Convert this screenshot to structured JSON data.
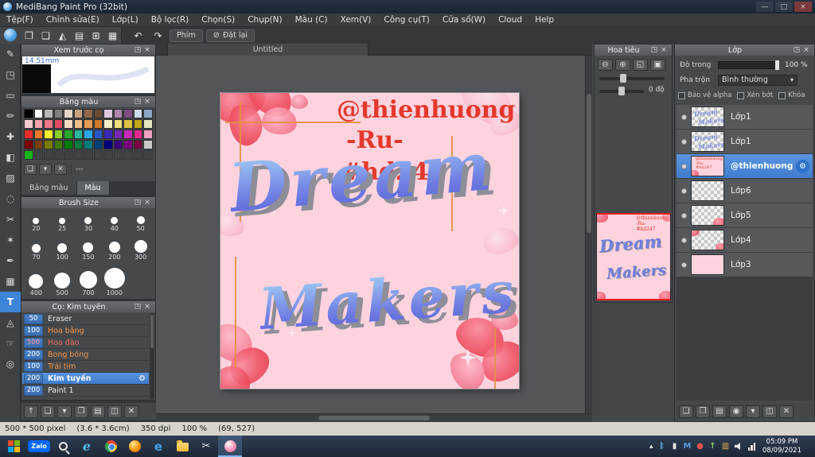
{
  "ui": {
    "popout": "◳",
    "close": "×",
    "gear": "⚙",
    "dropdown": "▾",
    "tray_expand": "▴"
  },
  "titlebar": {
    "title": "MediBang Paint Pro (32bit)",
    "min": "—",
    "max": "□",
    "close": "×"
  },
  "menubar": {
    "items": [
      "Tệp(F)",
      "Chỉnh sửa(E)",
      "Lớp(L)",
      "Bộ lọc(R)",
      "Chọn(S)",
      "Chụp(N)",
      "Màu (C)",
      "Xem(V)",
      "Công cụ(T)",
      "Cửa sổ(W)",
      "Cloud",
      "Help"
    ]
  },
  "toolbar": {
    "icons": [
      {
        "name": "new-canvas-icon",
        "glyph": "❐"
      },
      {
        "name": "save-icon",
        "glyph": "❏"
      },
      {
        "name": "comment-icon",
        "glyph": "◭"
      },
      {
        "name": "open-file-icon",
        "glyph": "▤"
      },
      {
        "name": "canvas-settings-icon",
        "glyph": "⊞"
      },
      {
        "name": "grid-icon",
        "glyph": "▦"
      }
    ],
    "undo": "↶",
    "redo": "↷",
    "key_button": "Phím",
    "reset_glyph": "⊘",
    "reset_button": "Đặt lại"
  },
  "tools": {
    "items": [
      {
        "name": "pen-tool",
        "glyph": "✎"
      },
      {
        "name": "eraser-tool",
        "glyph": "◳"
      },
      {
        "name": "select-rect-tool",
        "glyph": "▭"
      },
      {
        "name": "brush-tool",
        "glyph": "✏"
      },
      {
        "name": "move-tool",
        "glyph": "✚"
      },
      {
        "name": "fill-tool",
        "glyph": "◧"
      },
      {
        "name": "gradient-tool",
        "glyph": "▨"
      },
      {
        "name": "select-ellipse-tool",
        "glyph": "◌"
      },
      {
        "name": "lasso-tool",
        "glyph": "✂"
      },
      {
        "name": "magic-wand-tool",
        "glyph": "✶"
      },
      {
        "name": "pen-nib-tool",
        "glyph": "✒"
      },
      {
        "name": "transform-tool",
        "glyph": "▦"
      },
      {
        "name": "text-tool",
        "glyph": "T",
        "selected": true
      },
      {
        "name": "shape-tool",
        "glyph": "◬"
      },
      {
        "name": "hand-tool",
        "glyph": "☞"
      },
      {
        "name": "zoom-tool",
        "glyph": "◎"
      }
    ]
  },
  "preview": {
    "title": "Xem trước cọ",
    "size_label": "14.51mm"
  },
  "palette": {
    "title": "Bảng màu",
    "colors": [
      "#000000",
      "#ffffff",
      "#b9b9b9",
      "#7f7f7f",
      "#e5d5c5",
      "#caa27e",
      "#93684a",
      "#6b4a33",
      "#e0cade",
      "#af85ae",
      "#7e4f7e",
      "#cfdcea",
      "#89a8c8",
      "#f7cdd1",
      "#f2a3ad",
      "#ec7787",
      "#e14b60",
      "#f6dcc1",
      "#eebd8c",
      "#e39a52",
      "#d2782a",
      "#f7f0c6",
      "#eedd7d",
      "#ddc243",
      "#c3a618",
      "#e6e6c0",
      "#e82c2c",
      "#f07828",
      "#f8f028",
      "#88d028",
      "#28a828",
      "#28b89a",
      "#28a8e8",
      "#2858c8",
      "#3828b8",
      "#7828b8",
      "#c828b8",
      "#e8288a",
      "#f0a0c0",
      "#790000",
      "#7a3e00",
      "#7a7a00",
      "#3e7a00",
      "#007a00",
      "#007a3e",
      "#007a7a",
      "#003e7a",
      "#00007a",
      "#3e007a",
      "#7a007a",
      "#7a003e",
      "#c9c9c9",
      "#19b219",
      "",
      "",
      "",
      "",
      "",
      "",
      "",
      "",
      "",
      "",
      "",
      ""
    ],
    "action_icons": [
      {
        "name": "add-color-icon",
        "glyph": "❏"
      },
      {
        "name": "palette-menu-icon",
        "glyph": "▾"
      },
      {
        "name": "delete-color-icon",
        "glyph": "✕"
      }
    ],
    "swatch_label": "---",
    "tabs": [
      {
        "label": "Bảng màu",
        "active": false
      },
      {
        "label": "Màu",
        "active": true
      }
    ]
  },
  "brush_size": {
    "title": "Brush Size",
    "sizes": [
      20,
      25,
      30,
      40,
      50,
      70,
      100,
      150,
      200,
      300,
      400,
      500,
      700,
      1000
    ]
  },
  "brushes": {
    "title": "Cọ: Kim tuyến",
    "items": [
      {
        "size": "50",
        "name": "Eraser",
        "name_color": "#e8e8e8",
        "size_color": "#ffffff"
      },
      {
        "size": "100",
        "name": "Hoa bằng",
        "name_color": "#f0954a",
        "size_color": "#ffffff"
      },
      {
        "size": "500",
        "name": "Hoa đào",
        "name_color": "#ef6a5a",
        "size_color": "#ff9090"
      },
      {
        "size": "200",
        "name": "Bong bóng",
        "name_color": "#f0954a",
        "size_color": "#ffffff"
      },
      {
        "size": "100",
        "name": "Trái tim",
        "name_color": "#f0954a",
        "size_color": "#ffffff"
      },
      {
        "size": "200",
        "name": "Kim tuyến",
        "name_color": "#ffffff",
        "size_color": "#ffffff",
        "selected": true
      },
      {
        "size": "200",
        "name": "Paint 1",
        "name_color": "#e8e8e8",
        "size_color": "#ffffff"
      }
    ],
    "bottom_icons": [
      {
        "name": "brush-up-icon",
        "glyph": "↑"
      },
      {
        "name": "add-brush-icon",
        "glyph": "❏"
      },
      {
        "name": "brush-menu-icon",
        "glyph": "▾"
      },
      {
        "name": "duplicate-brush-icon",
        "glyph": "❐"
      },
      {
        "name": "brush-folder-icon",
        "glyph": "▤"
      },
      {
        "name": "copy-brush-icon",
        "glyph": "◫"
      },
      {
        "name": "delete-brush-icon",
        "glyph": "✕"
      }
    ]
  },
  "canvas": {
    "tab": "Untitled"
  },
  "artwork": {
    "line1": "@thienhuong",
    "line2": "-Ru-",
    "line3": "#hd247",
    "word1": "Dream",
    "word2": "Makers"
  },
  "navigator": {
    "title": "Hoa tiêu",
    "rotation": "0 độ",
    "buttons": [
      {
        "name": "zoom-out-icon",
        "glyph": "⊖"
      },
      {
        "name": "zoom-in-icon",
        "glyph": "⊕"
      },
      {
        "name": "fit-view-icon",
        "glyph": "◱"
      },
      {
        "name": "actual-size-icon",
        "glyph": "▣"
      }
    ]
  },
  "layers": {
    "title": "Lớp",
    "opacity_label": "Độ trong",
    "opacity_value": "100 %",
    "blend_label": "Pha trộn",
    "blend_value": "Bình thường",
    "checkboxes": [
      "Bảo vệ alpha",
      "Xén bớt",
      "Khóa"
    ],
    "items": [
      {
        "name": "Lớp1",
        "thumb": "words"
      },
      {
        "name": "Lớp1",
        "thumb": "words"
      },
      {
        "name": "@thienhuong",
        "thumb": "redtext",
        "selected": true
      },
      {
        "name": "Lớp6",
        "thumb": "empty"
      },
      {
        "name": "Lớp5",
        "thumb": "petal1"
      },
      {
        "name": "Lớp4",
        "thumb": "petal2"
      },
      {
        "name": "Lớp3",
        "thumb": "pink"
      }
    ],
    "bottom_icons": [
      {
        "name": "add-layer-icon",
        "glyph": "❏"
      },
      {
        "name": "duplicate-layer-icon",
        "glyph": "❐"
      },
      {
        "name": "layer-folder-icon",
        "glyph": "▤"
      },
      {
        "name": "camera-layer-icon",
        "glyph": "◉"
      },
      {
        "name": "merge-down-icon",
        "glyph": "▾"
      },
      {
        "name": "clear-layer-icon",
        "glyph": "◫"
      },
      {
        "name": "delete-layer-icon",
        "glyph": "✕"
      }
    ]
  },
  "statusbar": {
    "size": "500 * 500 pixel",
    "cm": "(3.6 * 3.6cm)",
    "dpi": "350 dpi",
    "zoom": "100 %",
    "coords": "(69, 527)"
  },
  "taskbar": {
    "apps": [
      {
        "name": "start-button",
        "kind": "start"
      },
      {
        "name": "zalo-taskbar-icon",
        "kind": "zalo",
        "label": "Zalo"
      },
      {
        "name": "search-taskbar-icon",
        "kind": "search"
      },
      {
        "name": "internet-explorer-taskbar-icon",
        "kind": "ie",
        "glyph": "e"
      },
      {
        "name": "chrome-taskbar-icon",
        "kind": "chrome"
      },
      {
        "name": "firefox-taskbar-icon",
        "kind": "firefox"
      },
      {
        "name": "edge-taskbar-icon",
        "kind": "edge",
        "glyph": "e"
      },
      {
        "name": "file-explorer-taskbar-icon",
        "kind": "folder"
      },
      {
        "name": "snipping-tool-taskbar-icon",
        "kind": "snip",
        "glyph": "✂"
      },
      {
        "name": "medibang-taskbar-icon",
        "kind": "medibang",
        "active": true
      }
    ],
    "tray": {
      "icons": [
        {
          "name": "bluetooth-tray-icon",
          "glyph": "ᛒ",
          "color": "#5ab4e8"
        },
        {
          "name": "battery-tray-icon",
          "glyph": "▮",
          "color": "#e8e8e8"
        },
        {
          "name": "blue-m-tray-icon",
          "glyph": "M",
          "color": "#5a9ae8"
        },
        {
          "name": "red-dot-tray-icon",
          "glyph": "●",
          "color": "#e05050"
        },
        {
          "name": "update-tray-icon",
          "glyph": "↑",
          "color": "#8fd06a"
        },
        {
          "name": "chart-tray-icon",
          "glyph": "▥",
          "color": "#e8b44a"
        }
      ],
      "clock_time": "05:09 PM",
      "clock_date": "08/09/2021"
    }
  }
}
